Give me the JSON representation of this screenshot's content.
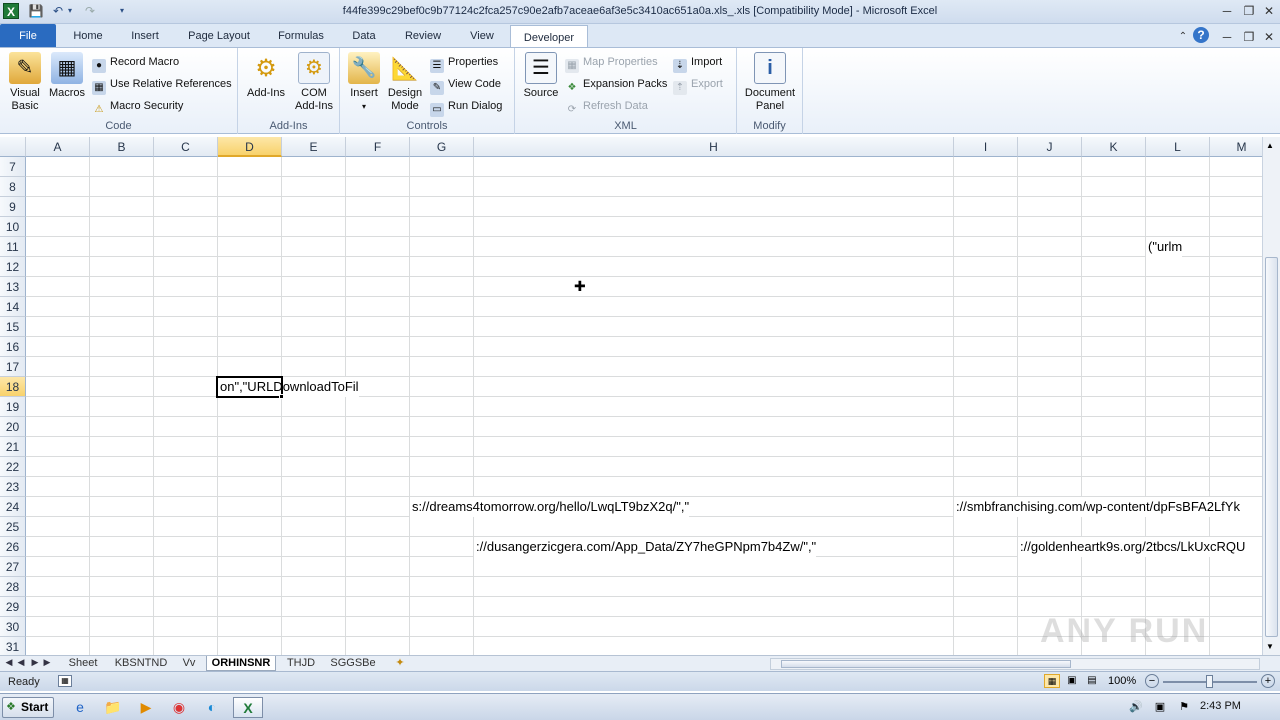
{
  "window": {
    "title": "f44fe399c29bef0c9b77124c2fca257c90e2afb7aceae6af3e5c3410ac651a0a.xls_.xls  [Compatibility Mode]  -  Microsoft Excel"
  },
  "ribbon_tabs": [
    "File",
    "Home",
    "Insert",
    "Page Layout",
    "Formulas",
    "Data",
    "Review",
    "View",
    "Developer"
  ],
  "active_tab": "Developer",
  "ribbon": {
    "code": {
      "label": "Code",
      "visual_basic": "Visual Basic",
      "visual_basic_l1": "Visual",
      "visual_basic_l2": "Basic",
      "macros": "Macros",
      "record_macro": "Record Macro",
      "use_relative": "Use Relative References",
      "macro_security": "Macro Security"
    },
    "addins": {
      "label": "Add-Ins",
      "addins_btn": "Add-Ins",
      "com_l1": "COM",
      "com_l2": "Add-Ins"
    },
    "controls": {
      "label": "Controls",
      "insert": "Insert",
      "design_l1": "Design",
      "design_l2": "Mode",
      "properties": "Properties",
      "view_code": "View Code",
      "run_dialog": "Run Dialog"
    },
    "xml": {
      "label": "XML",
      "source": "Source",
      "map_properties": "Map Properties",
      "expansion_packs": "Expansion Packs",
      "refresh_data": "Refresh Data",
      "import": "Import",
      "export": "Export"
    },
    "modify": {
      "label": "Modify",
      "doc_l1": "Document",
      "doc_l2": "Panel"
    }
  },
  "grid": {
    "columns": [
      "A",
      "B",
      "C",
      "D",
      "E",
      "F",
      "G",
      "H",
      "I",
      "J",
      "K",
      "L",
      "M"
    ],
    "rows": [
      "7",
      "8",
      "9",
      "10",
      "11",
      "12",
      "13",
      "14",
      "15",
      "16",
      "17",
      "18",
      "19",
      "20",
      "21",
      "22",
      "23",
      "24",
      "25",
      "26",
      "27",
      "28",
      "29",
      "30",
      "31"
    ],
    "selected_column": "D",
    "selected_row": "18",
    "cells": {
      "L11": "(\"urlm",
      "D18": "on\",\"URLDownloadToFil",
      "G24": "s://dreams4tomorrow.org/hello/LwqLT9bzX2q/\",\"",
      "I24": "://smbfranchising.com/wp-content/dpFsBFA2LfYk",
      "H26": "://dusangerzicgera.com/App_Data/ZY7heGPNpm7b4Zw/\",\"",
      "J26": "://goldenheartk9s.org/2tbcs/LkUxcRQU"
    }
  },
  "sheet_tabs": [
    "Sheet",
    "KBSNTND",
    "Vv",
    "ORHINSNR",
    "THJD",
    "SGGSBe"
  ],
  "active_sheet": "ORHINSNR",
  "status": {
    "ready": "Ready",
    "zoom": "100%"
  },
  "taskbar": {
    "start": "Start",
    "clock": "2:43 PM"
  },
  "watermark": "ANY RUN"
}
